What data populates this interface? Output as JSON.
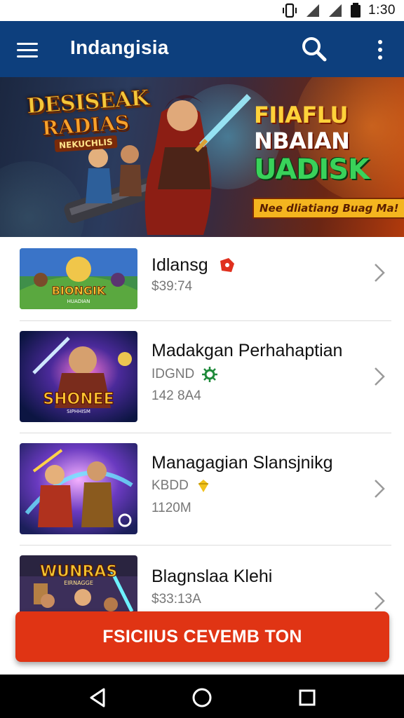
{
  "status_bar": {
    "time": "1:30"
  },
  "app_bar": {
    "title": "Indangisia"
  },
  "banner": {
    "logo_line1": "DESISEAK",
    "logo_line2": "RADIAS",
    "logo_line3": "NEKUCHLIS",
    "promo_line1": "FIIAFLU",
    "promo_line2": "NBAIAN",
    "promo_line3": "UADISK",
    "promo_tag": "Nee dliatiang Buag Ma!"
  },
  "games": [
    {
      "name": "Idlansg",
      "price": "$39:74",
      "badge_icon": "red-tag-icon",
      "thumb_text": "BIONGIK",
      "thumb_sub": "HUADIAN"
    },
    {
      "name": "Madakgan Perhahaptian",
      "price": "IDGND",
      "size": "142 8A4",
      "badge_icon": "green-gear-icon",
      "thumb_text": "SHONEE",
      "thumb_sub": "SIPHHISM"
    },
    {
      "name": "Managagian Slansjnikg",
      "price": "KBDD",
      "size": "1120M",
      "badge_icon": "gold-diamond-icon",
      "thumb_text": "",
      "thumb_sub": ""
    },
    {
      "name": "Blagnslaa Klehi",
      "price": "$33:13A",
      "badge_icon": "",
      "thumb_text": "WUNRAS",
      "thumb_sub": "EIRNAGGE"
    }
  ],
  "cta": {
    "label": "FSICIIUS CEVEMB TON"
  },
  "colors": {
    "app_bar": "#0d3f7d",
    "cta": "#e03414",
    "nav_bar": "#000000"
  }
}
